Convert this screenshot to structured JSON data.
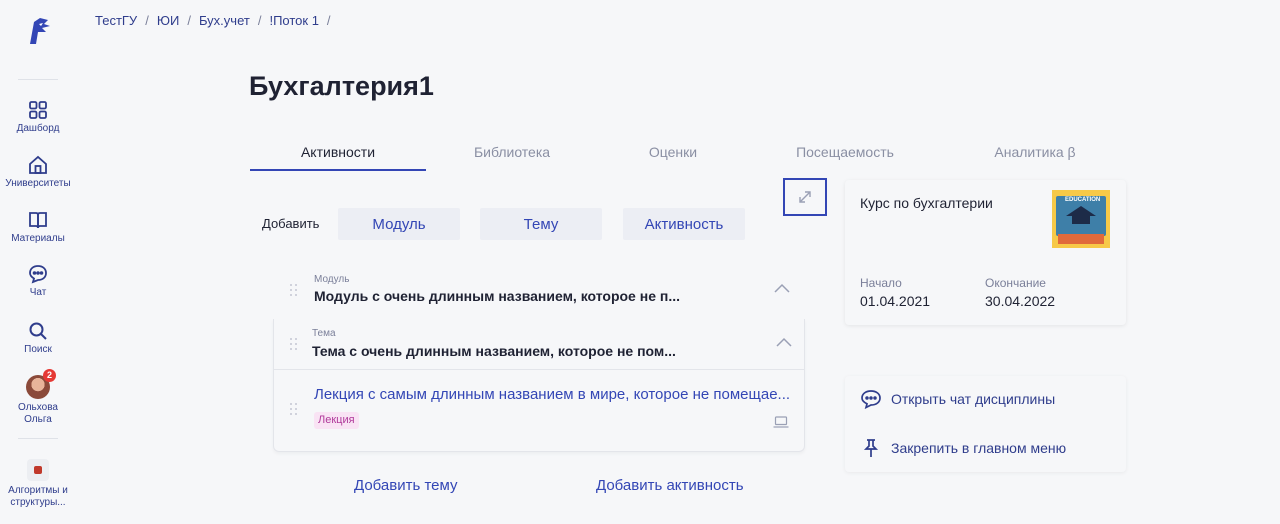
{
  "breadcrumb": [
    "ТестГУ",
    "ЮИ",
    "Бух.учет",
    "!Поток 1"
  ],
  "page_title": "Бухгалтерия1",
  "sidebar": {
    "items": [
      {
        "label": "Дашборд",
        "icon": "dashboard-icon"
      },
      {
        "label": "Университеты",
        "icon": "university-icon"
      },
      {
        "label": "Материалы",
        "icon": "book-icon"
      },
      {
        "label": "Чат",
        "icon": "chat-icon"
      },
      {
        "label": "Поиск",
        "icon": "search-icon"
      }
    ],
    "user": {
      "name_line1": "Ольхова",
      "name_line2": "Ольга",
      "badge": "2"
    },
    "course": {
      "line1": "Алгоритмы и",
      "line2": "структуры..."
    }
  },
  "tabs": [
    "Активности",
    "Библиотека",
    "Оценки",
    "Посещаемость",
    "Аналитика β"
  ],
  "add": {
    "label": "Добавить",
    "buttons": [
      "Модуль",
      "Тему",
      "Активность"
    ]
  },
  "module": {
    "caption": "Модуль",
    "title": "Модуль с очень длинным названием, которое не п..."
  },
  "topic": {
    "caption": "Тема",
    "title": "Тема с очень длинным названием, которое не пом..."
  },
  "lesson": {
    "title": "Лекция с самым длинным названием в мире, которое не помещае...",
    "badge": "Лекция"
  },
  "bottom_links": {
    "add_topic": "Добавить тему",
    "add_activity": "Добавить активность"
  },
  "course_info": {
    "name": "Курс по бухгалтерии",
    "image_text": "EDUCATION",
    "start_label": "Начало",
    "start_value": "01.04.2021",
    "end_label": "Окончание",
    "end_value": "30.04.2022"
  },
  "actions": {
    "open_chat": "Открыть чат дисциплины",
    "pin": "Закрепить в главном меню"
  },
  "colors": {
    "accent": "#3346b5",
    "nav": "#2f3d8c",
    "badge": "#e53935",
    "lesson_badge_bg": "#f9e3f4"
  }
}
